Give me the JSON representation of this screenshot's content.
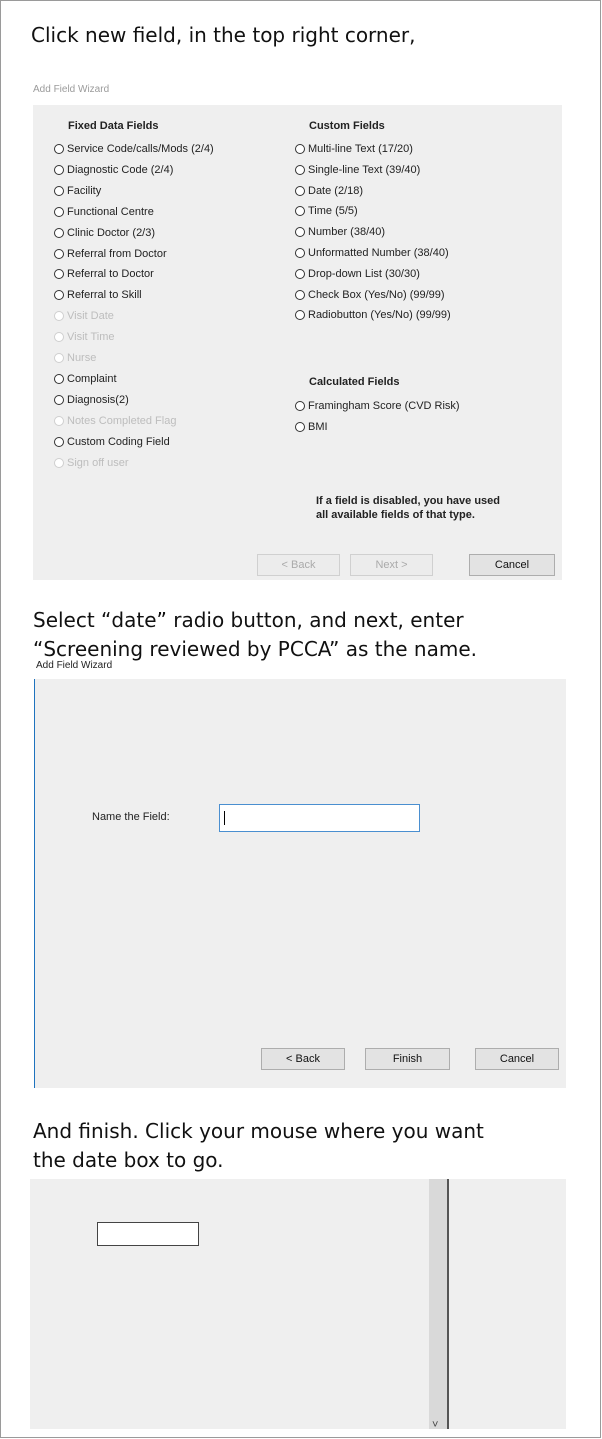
{
  "instructions": {
    "step1": "Click new field, in the top right corner,",
    "step2_line1": "Select  “date” radio button, and next, enter",
    "step2_line2": "“Screening  reviewed  by PCCA” as the name.",
    "step3_line1": "And finish. Click your mouse where you want",
    "step3_line2": "the date box to go."
  },
  "wizard1": {
    "title": "Add Field Wizard",
    "fixed_header": "Fixed Data Fields",
    "custom_header": "Custom Fields",
    "calculated_header": "Calculated Fields",
    "fixed_fields": [
      {
        "label": "Service Code/calls/Mods (2/4)",
        "enabled": true
      },
      {
        "label": "Diagnostic Code (2/4)",
        "enabled": true
      },
      {
        "label": "Facility",
        "enabled": true
      },
      {
        "label": "Functional Centre",
        "enabled": true
      },
      {
        "label": "Clinic Doctor (2/3)",
        "enabled": true
      },
      {
        "label": "Referral from Doctor",
        "enabled": true
      },
      {
        "label": "Referral to Doctor",
        "enabled": true
      },
      {
        "label": "Referral to Skill",
        "enabled": true
      },
      {
        "label": "Visit Date",
        "enabled": false
      },
      {
        "label": "Visit Time",
        "enabled": false
      },
      {
        "label": "Nurse",
        "enabled": false
      },
      {
        "label": "Complaint",
        "enabled": true
      },
      {
        "label": "Diagnosis(2)",
        "enabled": true
      },
      {
        "label": "Notes Completed Flag",
        "enabled": false
      },
      {
        "label": "Custom Coding Field",
        "enabled": true
      },
      {
        "label": "Sign off user",
        "enabled": false
      }
    ],
    "custom_fields": [
      {
        "label": "Multi-line Text (17/20)",
        "enabled": true
      },
      {
        "label": "Single-line Text (39/40)",
        "enabled": true
      },
      {
        "label": "Date (2/18)",
        "enabled": true
      },
      {
        "label": "Time (5/5)",
        "enabled": true
      },
      {
        "label": "Number (38/40)",
        "enabled": true
      },
      {
        "label": "Unformatted Number (38/40)",
        "enabled": true
      },
      {
        "label": "Drop-down List (30/30)",
        "enabled": true
      },
      {
        "label": "Check Box (Yes/No) (99/99)",
        "enabled": true
      },
      {
        "label": "Radiobutton (Yes/No) (99/99)",
        "enabled": true
      }
    ],
    "calculated_fields": [
      {
        "label": "Framingham Score (CVD Risk)",
        "enabled": true
      },
      {
        "label": "BMI",
        "enabled": true
      }
    ],
    "note_line1": "If a field is disabled, you have used",
    "note_line2": "all available fields of that type.",
    "back_label": "< Back",
    "next_label": "Next >",
    "cancel_label": "Cancel"
  },
  "wizard2": {
    "title": "Add Field Wizard",
    "name_label": "Name the Field:",
    "name_value": "",
    "back_label": "< Back",
    "finish_label": "Finish",
    "cancel_label": "Cancel"
  },
  "canvas": {
    "scroll_arrow": "˅"
  }
}
